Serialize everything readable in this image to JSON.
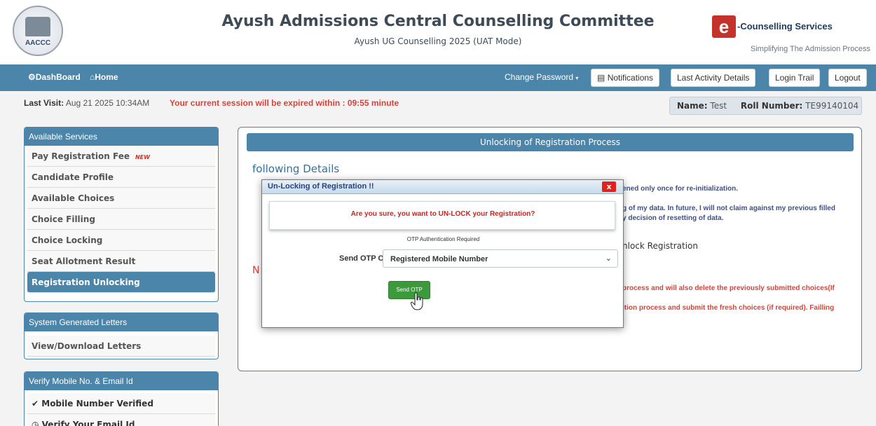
{
  "header": {
    "logo_text": "AACCC",
    "title": "Ayush Admissions Central Counselling Committee",
    "subtitle": "Ayush UG Counselling 2025 (UAT Mode)",
    "ec_logo_letter": "e",
    "ec_title": "-Counselling Services",
    "ec_tagline": "Simplifying The Admission Process"
  },
  "nav": {
    "dashboard": "DashBoard",
    "home": "Home",
    "change_password": "Change Password",
    "notifications": "Notifications",
    "last_activity": "Last Activity Details",
    "login_trail": "Login Trail",
    "logout": "Logout"
  },
  "session": {
    "last_visit_label": "Last Visit:",
    "last_visit_value": "Aug 21 2025 10:34AM",
    "expiry_message": "Your current session will be expired within : 09:55 minute",
    "name_label": "Name:",
    "name_value": "Test",
    "roll_label": "Roll Number:",
    "roll_value": "TE99140104"
  },
  "sidebar": {
    "services_title": "Available Services",
    "services": [
      {
        "label": "Pay Registration Fee",
        "badge": "NEW"
      },
      {
        "label": "Candidate Profile"
      },
      {
        "label": "Available Choices"
      },
      {
        "label": "Choice Filling"
      },
      {
        "label": "Choice Locking"
      },
      {
        "label": "Seat Allotment Result"
      },
      {
        "label": "Registration Unlocking"
      }
    ],
    "letters_title": "System Generated Letters",
    "letters": [
      {
        "label": "View/Download Letters"
      }
    ],
    "verify_title": "Verify Mobile No. & Email Id",
    "verify": [
      {
        "label": "Mobile Number Verified"
      },
      {
        "label": "Verify Your Email Id"
      }
    ]
  },
  "main": {
    "title": "Unlocking of Registration Process",
    "following": "following Details",
    "line1": "ened only once for re-initialization.",
    "line2a": "g of my data. In future, I will not claim against my previous filled",
    "line2b": "y decision of resetting of data.",
    "unlock_text": "nlock Registration",
    "n_text": "N",
    "red1": "process and will also delete the previously submitted choices(If",
    "red2": "ition process and submit the fresh choices (if required). Failling"
  },
  "modal": {
    "title": "Un-Locking of Registration !!",
    "close": "x",
    "confirm": "Are you sure, you want to UN-LOCK your Registration?",
    "otp_required": "OTP Authentication Required",
    "send_label": "Send OTP On :",
    "send_value": "Registered Mobile Number",
    "send_button": "Send OTP"
  },
  "colors": {
    "primary": "#4b85aa",
    "alert_red": "#d9423a",
    "success_green": "#3c9a3c"
  }
}
